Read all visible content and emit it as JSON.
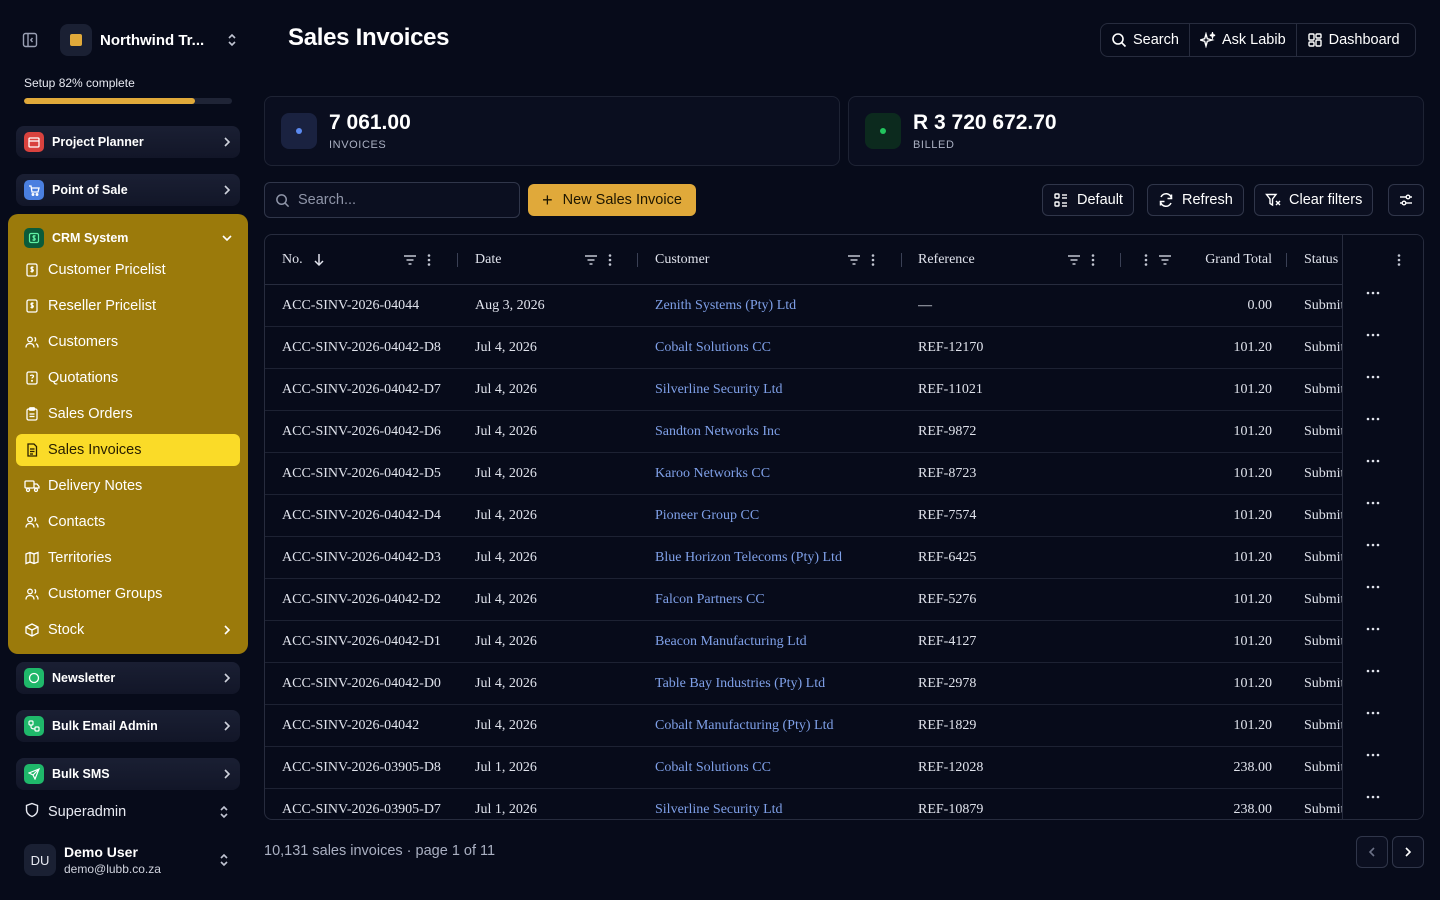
{
  "org": {
    "name": "Northwind Tr..."
  },
  "setup": {
    "label": "Setup 82% complete",
    "progress": 0.82
  },
  "nav": {
    "project_planner": "Project Planner",
    "point_of_sale": "Point of Sale",
    "crm": {
      "label": "CRM System",
      "items": [
        {
          "label": "Customer Pricelist",
          "icon": "dollar-doc-icon"
        },
        {
          "label": "Reseller Pricelist",
          "icon": "dollar-doc-icon"
        },
        {
          "label": "Customers",
          "icon": "users-icon"
        },
        {
          "label": "Quotations",
          "icon": "quote-doc-icon"
        },
        {
          "label": "Sales Orders",
          "icon": "clipboard-icon"
        },
        {
          "label": "Sales Invoices",
          "icon": "invoice-icon"
        },
        {
          "label": "Delivery Notes",
          "icon": "truck-icon"
        },
        {
          "label": "Contacts",
          "icon": "users-icon"
        },
        {
          "label": "Territories",
          "icon": "map-icon"
        },
        {
          "label": "Customer Groups",
          "icon": "users-icon"
        },
        {
          "label": "Stock",
          "icon": "box-icon"
        }
      ]
    },
    "newsletter": "Newsletter",
    "bulk_email": "Bulk Email Admin",
    "bulk_sms": "Bulk SMS",
    "superadmin": "Superadmin"
  },
  "user": {
    "initials": "DU",
    "name": "Demo User",
    "email": "demo@lubb.co.za"
  },
  "page": {
    "title": "Sales Invoices"
  },
  "topbar": {
    "search": "Search",
    "ask": "Ask Labib",
    "dashboard": "Dashboard"
  },
  "stats": {
    "invoices": {
      "value": "7 061.00",
      "label": "INVOICES"
    },
    "billed": {
      "value": "R 3 720 672.70",
      "label": "BILLED"
    }
  },
  "toolbar": {
    "search_placeholder": "Search...",
    "new_label": "New Sales Invoice",
    "default_label": "Default",
    "refresh_label": "Refresh",
    "clear_label": "Clear filters"
  },
  "table": {
    "columns": {
      "no": "No.",
      "date": "Date",
      "customer": "Customer",
      "reference": "Reference",
      "grand_total": "Grand Total",
      "status": "Status"
    },
    "rows": [
      {
        "no": "ACC-SINV-2026-04044",
        "date": "Aug 3, 2026",
        "customer": "Zenith Systems (Pty) Ltd",
        "reference": "—",
        "total": "0.00",
        "status": "Submitted"
      },
      {
        "no": "ACC-SINV-2026-04042-D8",
        "date": "Jul 4, 2026",
        "customer": "Cobalt Solutions CC",
        "reference": "REF-12170",
        "total": "101.20",
        "status": "Submitted"
      },
      {
        "no": "ACC-SINV-2026-04042-D7",
        "date": "Jul 4, 2026",
        "customer": "Silverline Security Ltd",
        "reference": "REF-11021",
        "total": "101.20",
        "status": "Submitted"
      },
      {
        "no": "ACC-SINV-2026-04042-D6",
        "date": "Jul 4, 2026",
        "customer": "Sandton Networks Inc",
        "reference": "REF-9872",
        "total": "101.20",
        "status": "Submitted"
      },
      {
        "no": "ACC-SINV-2026-04042-D5",
        "date": "Jul 4, 2026",
        "customer": "Karoo Networks CC",
        "reference": "REF-8723",
        "total": "101.20",
        "status": "Submitted"
      },
      {
        "no": "ACC-SINV-2026-04042-D4",
        "date": "Jul 4, 2026",
        "customer": "Pioneer Group CC",
        "reference": "REF-7574",
        "total": "101.20",
        "status": "Submitted"
      },
      {
        "no": "ACC-SINV-2026-04042-D3",
        "date": "Jul 4, 2026",
        "customer": "Blue Horizon Telecoms (Pty) Ltd",
        "reference": "REF-6425",
        "total": "101.20",
        "status": "Submitted"
      },
      {
        "no": "ACC-SINV-2026-04042-D2",
        "date": "Jul 4, 2026",
        "customer": "Falcon Partners CC",
        "reference": "REF-5276",
        "total": "101.20",
        "status": "Submitted"
      },
      {
        "no": "ACC-SINV-2026-04042-D1",
        "date": "Jul 4, 2026",
        "customer": "Beacon Manufacturing Ltd",
        "reference": "REF-4127",
        "total": "101.20",
        "status": "Submitted"
      },
      {
        "no": "ACC-SINV-2026-04042-D0",
        "date": "Jul 4, 2026",
        "customer": "Table Bay Industries (Pty) Ltd",
        "reference": "REF-2978",
        "total": "101.20",
        "status": "Submitted"
      },
      {
        "no": "ACC-SINV-2026-04042",
        "date": "Jul 4, 2026",
        "customer": "Cobalt Manufacturing (Pty) Ltd",
        "reference": "REF-1829",
        "total": "101.20",
        "status": "Submitted"
      },
      {
        "no": "ACC-SINV-2026-03905-D8",
        "date": "Jul 1, 2026",
        "customer": "Cobalt Solutions CC",
        "reference": "REF-12028",
        "total": "238.00",
        "status": "Submitted"
      },
      {
        "no": "ACC-SINV-2026-03905-D7",
        "date": "Jul 1, 2026",
        "customer": "Silverline Security Ltd",
        "reference": "REF-10879",
        "total": "238.00",
        "status": "Submitted"
      }
    ]
  },
  "footer": {
    "summary": "10,131 sales invoices · page 1 of 11"
  }
}
